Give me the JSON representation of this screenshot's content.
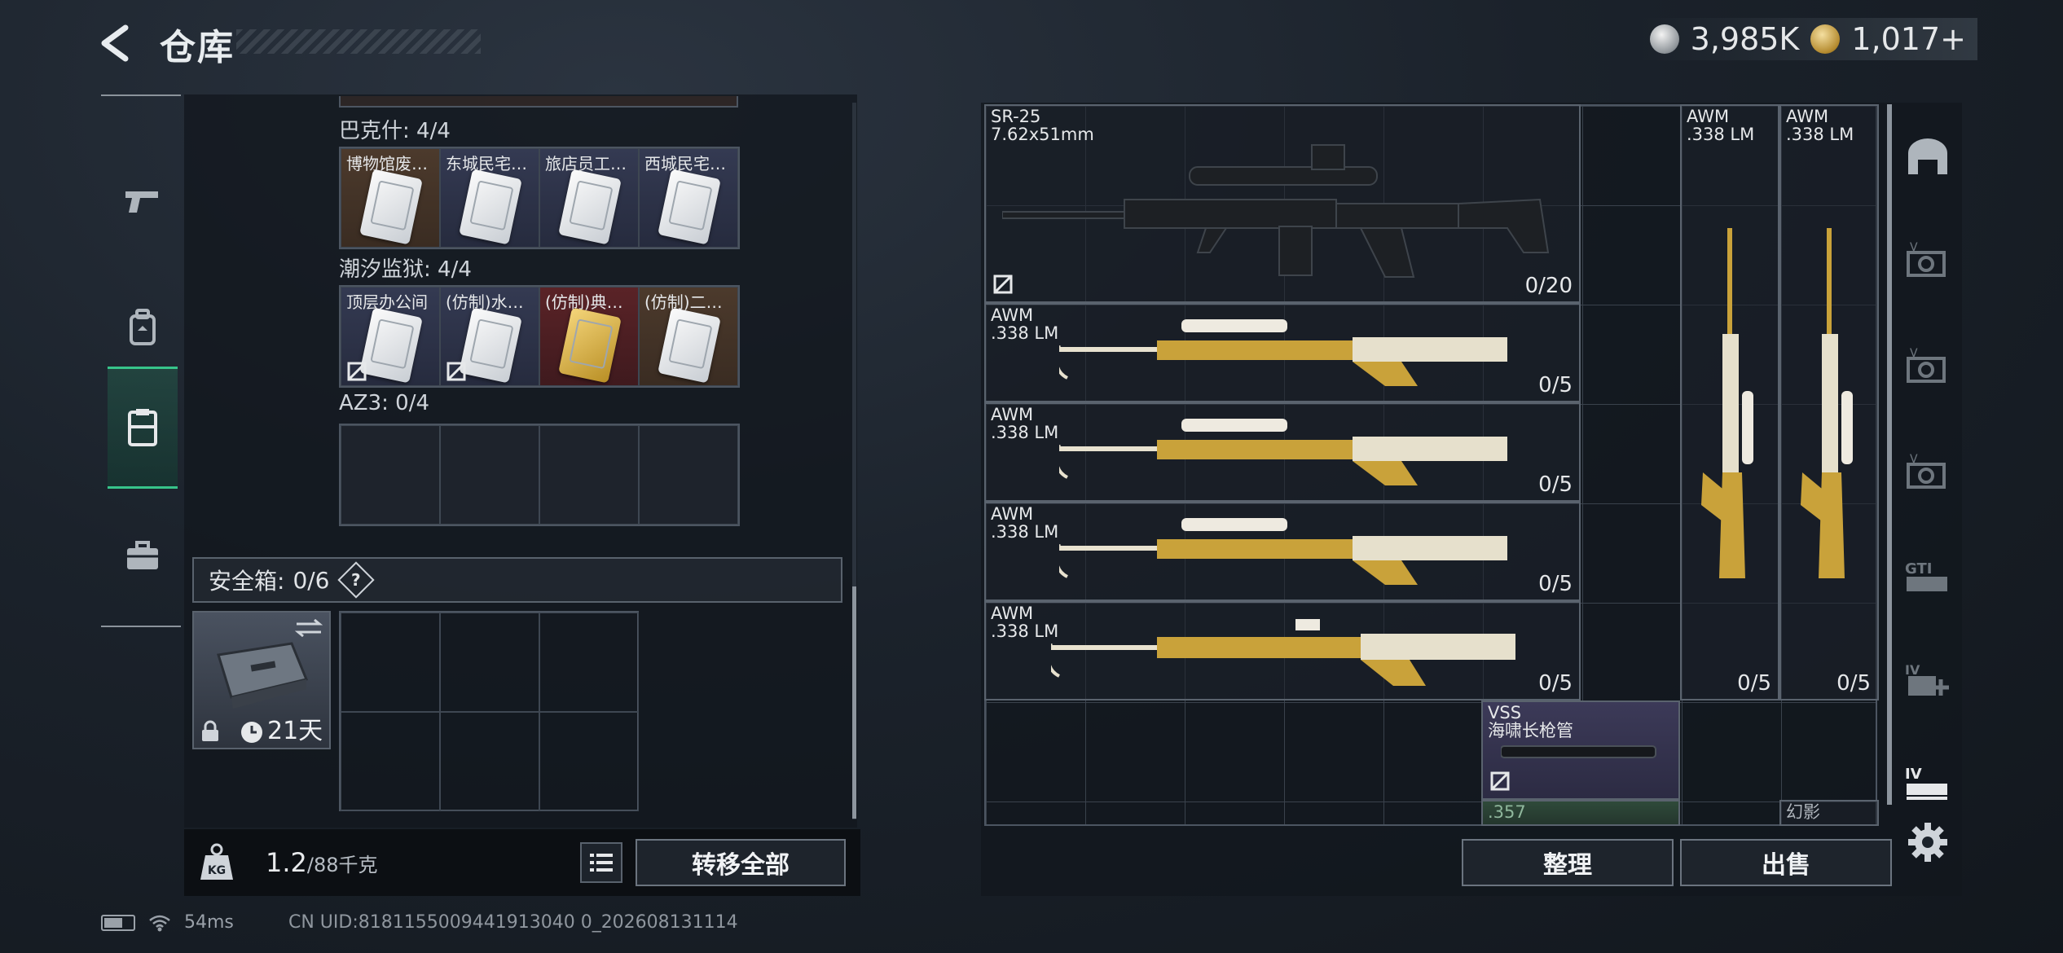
{
  "header": {
    "title": "仓库"
  },
  "currency": {
    "silver": "3,985K",
    "gold": "1,017+"
  },
  "left": {
    "groups": [
      {
        "label": "巴克什: 4/4",
        "items": [
          {
            "name": "博物馆废…",
            "tone": "brown"
          },
          {
            "name": "东城民宅…",
            "tone": "blue"
          },
          {
            "name": "旅店员工…",
            "tone": "blue"
          },
          {
            "name": "西城民宅…",
            "tone": "blue"
          }
        ]
      },
      {
        "label": "潮汐监狱: 4/4",
        "items": [
          {
            "name": "顶层办公间",
            "tone": "blue"
          },
          {
            "name": "(仿制)水…",
            "tone": "blue"
          },
          {
            "name": "(仿制)典…",
            "tone": "red"
          },
          {
            "name": "(仿制)二…",
            "tone": "brown"
          }
        ]
      },
      {
        "label": "AZ3: 0/4",
        "items": []
      }
    ],
    "safebox": {
      "label": "安全箱:",
      "count": "0/6",
      "help": "?",
      "timer": "21天"
    },
    "weight": {
      "value": "1.2",
      "capacity": "/88千克"
    },
    "transfer_label": "转移全部"
  },
  "right": {
    "weapons": {
      "sr25": {
        "name": "SR-25\n7.62x51mm",
        "ammo": "0/20"
      },
      "awm1": {
        "name": "AWM\n.338 LM",
        "ammo": "0/5"
      },
      "awm2": {
        "name": "AWM\n.338 LM",
        "ammo": "0/5"
      },
      "awm3": {
        "name": "AWM\n.338 LM",
        "ammo": "0/5"
      },
      "awm4": {
        "name": "AWM\n.338 LM",
        "ammo": "0/5"
      },
      "awmv1": {
        "name": "AWM\n.338 LM",
        "ammo": "0/5"
      },
      "awmv2": {
        "name": "AWM\n.338 LM",
        "ammo": "0/5"
      },
      "vss": {
        "name": "VSS\n海啸长枪管"
      },
      "ammo357": {
        "name": ".357"
      },
      "phantom": {
        "name": "幻影"
      }
    },
    "sort_label": "整理",
    "sell_label": "出售"
  },
  "footer": {
    "ping": "54ms",
    "uid": "CN UID:8181155009441913040 0_202608131114"
  },
  "colors": {
    "accent_green": "#37c48a",
    "gold": "#c9a23a"
  }
}
